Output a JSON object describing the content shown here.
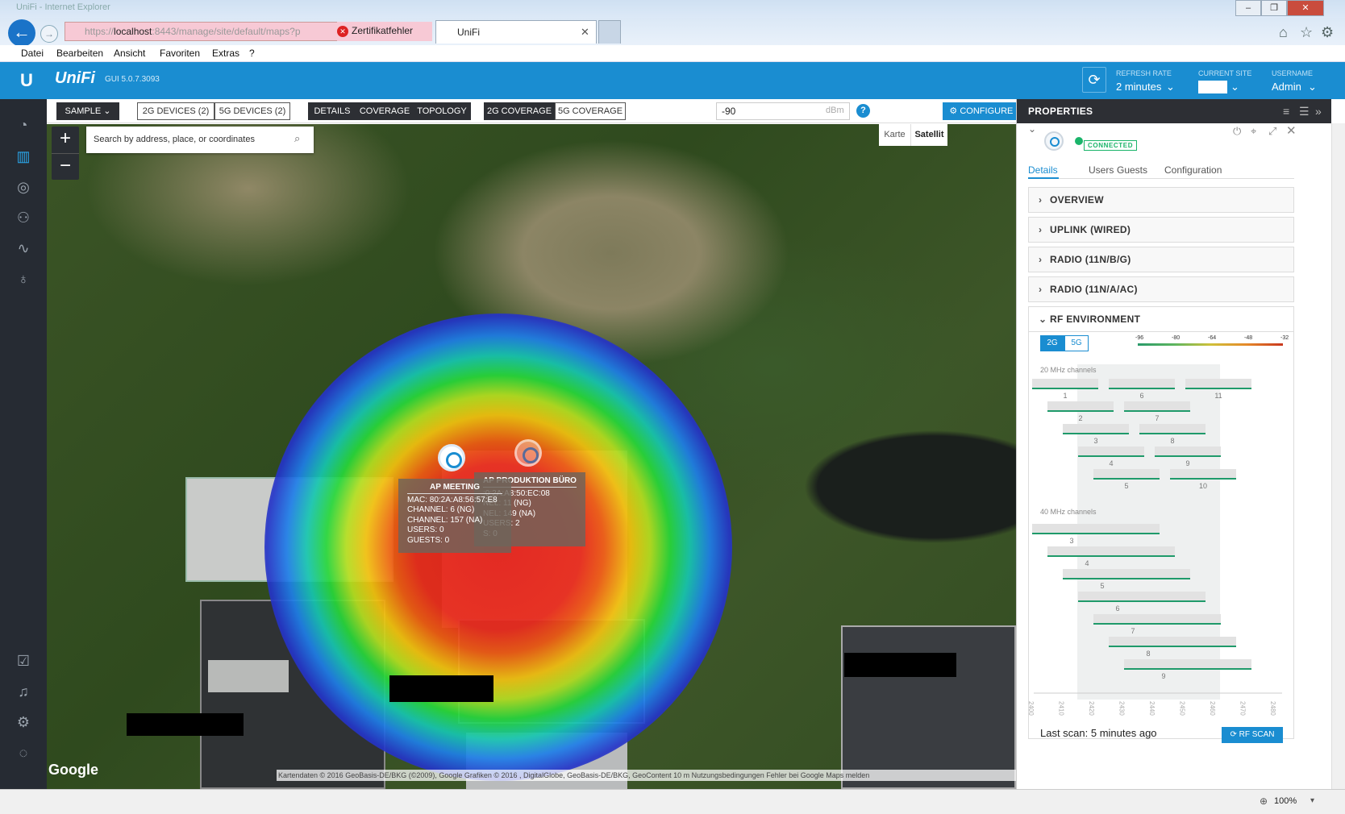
{
  "browser": {
    "title": "UniFi - Internet Explorer",
    "address_dim": "https://",
    "address_host": "localhost",
    "address_rest": ":8443/manage/site/default/maps?p",
    "cert_error": "Zertifikatfehler",
    "tab_title": "UniFi",
    "zoom": "100%",
    "menu": [
      "Datei",
      "Bearbeiten",
      "Ansicht",
      "Favoriten",
      "Extras",
      "?"
    ]
  },
  "header": {
    "brand": "UniFi",
    "version": "GUI 5.0.7.3093",
    "refresh_label": "REFRESH RATE",
    "refresh_value": "2 minutes",
    "site_label": "CURRENT SITE",
    "user_label": "USERNAME",
    "user_value": "Admin"
  },
  "toolbar": {
    "sample": "SAMPLE",
    "devices_2g": "2G DEVICES (2)",
    "devices_5g": "5G DEVICES (2)",
    "details": "DETAILS",
    "coverage": "COVERAGE",
    "topology": "TOPOLOGY",
    "coverage_2g": "2G COVERAGE",
    "coverage_5g": "5G COVERAGE",
    "dbm_value": "-90",
    "dbm_unit": "dBm",
    "help": "?",
    "configure_maps": "CONFIGURE MAPS"
  },
  "map": {
    "search_placeholder": "Search by address, place, or coordinates",
    "karte": "Karte",
    "satellit": "Satellit",
    "google": "Google",
    "attribution": "Kartendaten © 2016 GeoBasis-DE/BKG (©2009), Google Grafiken © 2016 , DigitalGlobe, GeoBasis-DE/BKG, GeoContent   10 m   Nutzungsbedingungen   Fehler bei Google Maps melden",
    "ap1": {
      "name": "AP MEETING",
      "mac": "MAC: 80:2A:A8:56:57:E8",
      "ch1": "CHANNEL: 6 (NG)",
      "ch2": "CHANNEL: 157 (NA)",
      "users": "USERS: 0",
      "guests": "GUESTS: 0"
    },
    "ap2": {
      "name": "AP PRODUKTION BÜRO",
      "mac": ":0:2A:A8:50:EC:08",
      "ch1": "NEL: 11 (NG)",
      "ch2": "NEL: 149 (NA)",
      "users": "USERS: 2",
      "guests": "S: 0"
    }
  },
  "properties": {
    "title": "PROPERTIES",
    "status": "CONNECTED",
    "tabs": [
      "Details",
      "Users",
      "Guests",
      "Configuration"
    ],
    "sections": [
      "OVERVIEW",
      "UPLINK (WIRED)",
      "RADIO (11N/B/G)",
      "RADIO (11N/A/AC)",
      "RF ENVIRONMENT"
    ],
    "band_2g": "2G",
    "band_5g": "5G",
    "scale": [
      "-96",
      "-80",
      "-64",
      "-48",
      "-32"
    ],
    "ch20_label": "20 MHz channels",
    "ch20": [
      "1",
      "6",
      "11",
      "2",
      "7",
      "3",
      "8",
      "4",
      "9",
      "5",
      "10"
    ],
    "ch40_label": "40 MHz channels",
    "ch40": [
      "3",
      "4",
      "5",
      "6",
      "7",
      "8",
      "9"
    ],
    "freq_axis": [
      "2400",
      "2410",
      "2420",
      "2430",
      "2440",
      "2450",
      "2460",
      "2470",
      "2480"
    ],
    "last_scan": "Last scan: 5 minutes ago",
    "rf_scan": "RF SCAN"
  }
}
